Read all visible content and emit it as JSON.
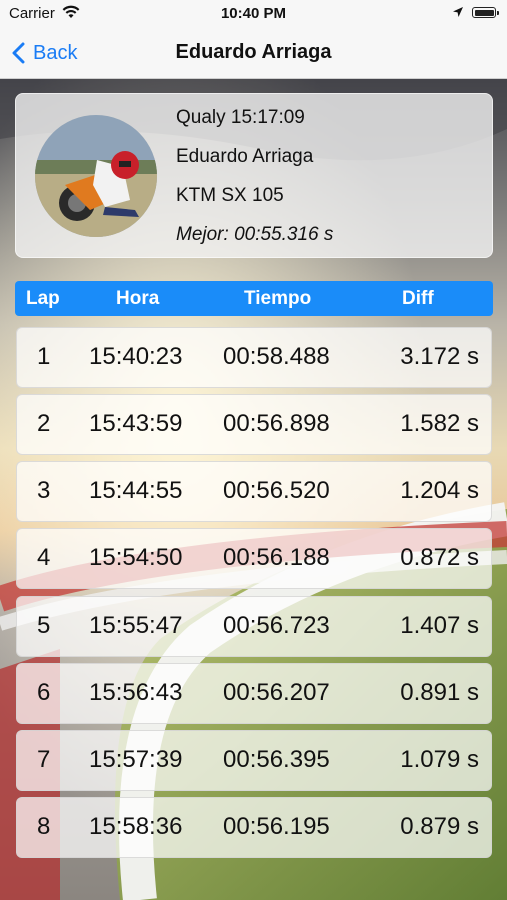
{
  "status_bar": {
    "carrier": "Carrier",
    "time": "10:40 PM"
  },
  "nav": {
    "back_label": "Back",
    "title": "Eduardo Arriaga"
  },
  "rider": {
    "session": "Qualy 15:17:09",
    "name": "Eduardo Arriaga",
    "bike": "KTM SX 105",
    "best": "Mejor: 00:55.316 s"
  },
  "table": {
    "headers": {
      "lap": "Lap",
      "hora": "Hora",
      "tiempo": "Tiempo",
      "diff": "Diff"
    },
    "rows": [
      {
        "lap": "1",
        "hora": "15:40:23",
        "tiempo": "00:58.488",
        "diff": "3.172 s"
      },
      {
        "lap": "2",
        "hora": "15:43:59",
        "tiempo": "00:56.898",
        "diff": "1.582 s"
      },
      {
        "lap": "3",
        "hora": "15:44:55",
        "tiempo": "00:56.520",
        "diff": "1.204 s"
      },
      {
        "lap": "4",
        "hora": "15:54:50",
        "tiempo": "00:56.188",
        "diff": "0.872 s"
      },
      {
        "lap": "5",
        "hora": "15:55:47",
        "tiempo": "00:56.723",
        "diff": "1.407 s"
      },
      {
        "lap": "6",
        "hora": "15:56:43",
        "tiempo": "00:56.207",
        "diff": "0.891 s"
      },
      {
        "lap": "7",
        "hora": "15:57:39",
        "tiempo": "00:56.395",
        "diff": "1.079 s"
      },
      {
        "lap": "8",
        "hora": "15:58:36",
        "tiempo": "00:56.195",
        "diff": "0.879 s"
      }
    ]
  },
  "colors": {
    "accent": "#1a8cf9",
    "link": "#1a7cf5"
  }
}
